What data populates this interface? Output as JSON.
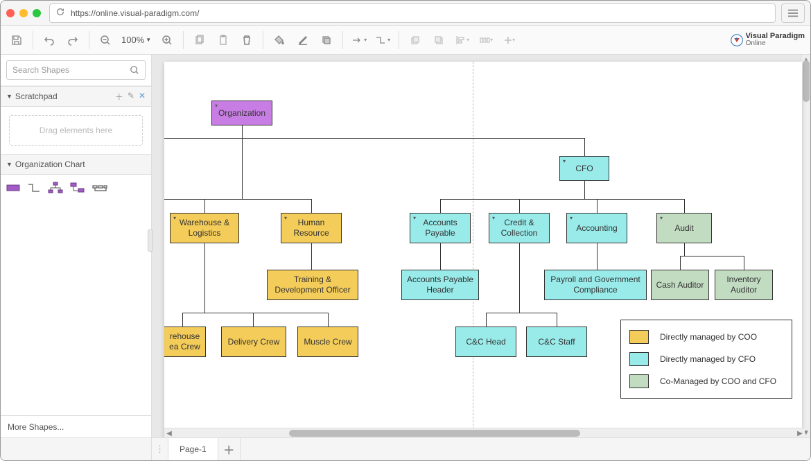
{
  "url": "https://online.visual-paradigm.com/",
  "brand": {
    "name": "Visual Paradigm",
    "sub": "Online"
  },
  "toolbar": {
    "zoom": "100%"
  },
  "sidebar": {
    "search_placeholder": "Search Shapes",
    "scratchpad_title": "Scratchpad",
    "dropzone_text": "Drag elements here",
    "orgchart_title": "Organization Chart",
    "more_shapes": "More Shapes..."
  },
  "tabs": {
    "page1": "Page-1"
  },
  "nodes": {
    "organization": "Organization",
    "cfo": "CFO",
    "warehouse": "Warehouse & Logistics",
    "hr": "Human Resource",
    "accounts_payable": "Accounts Payable",
    "credit": "Credit & Collection",
    "accounting": "Accounting",
    "audit": "Audit",
    "training": "Training & Development Officer",
    "ap_header": "Accounts Payable Header",
    "payroll": "Payroll and Government Compliance",
    "cash_auditor": "Cash Auditor",
    "inventory_auditor": "Inventory Auditor",
    "warehouse_crew": "rehouse ea Crew",
    "delivery_crew": "Delivery Crew",
    "muscle_crew": "Muscle Crew",
    "cc_head": "C&C Head",
    "cc_staff": "C&C Staff"
  },
  "legend": {
    "coo": "Directly managed by COO",
    "cfo": "Directly managed by CFO",
    "both": "Co-Managed by COO and CFO"
  },
  "chart_data": {
    "type": "org-chart",
    "root": "Organization",
    "colors": {
      "coo_managed": "#f4cc5a",
      "cfo_managed": "#99ebea",
      "co_managed": "#c2dcc2",
      "root": "#c77de3"
    },
    "nodes": [
      {
        "id": "organization",
        "label": "Organization",
        "group": "root",
        "parent": null
      },
      {
        "id": "cfo",
        "label": "CFO",
        "group": "cfo_managed",
        "parent": "organization"
      },
      {
        "id": "warehouse",
        "label": "Warehouse & Logistics",
        "group": "coo_managed",
        "parent": "organization"
      },
      {
        "id": "hr",
        "label": "Human Resource",
        "group": "coo_managed",
        "parent": "organization"
      },
      {
        "id": "accounts_payable",
        "label": "Accounts Payable",
        "group": "cfo_managed",
        "parent": "cfo"
      },
      {
        "id": "credit",
        "label": "Credit & Collection",
        "group": "cfo_managed",
        "parent": "cfo"
      },
      {
        "id": "accounting",
        "label": "Accounting",
        "group": "cfo_managed",
        "parent": "cfo"
      },
      {
        "id": "audit",
        "label": "Audit",
        "group": "co_managed",
        "parent": "cfo"
      },
      {
        "id": "training",
        "label": "Training & Development Officer",
        "group": "coo_managed",
        "parent": "hr"
      },
      {
        "id": "ap_header",
        "label": "Accounts Payable Header",
        "group": "cfo_managed",
        "parent": "accounts_payable"
      },
      {
        "id": "payroll",
        "label": "Payroll and Government Compliance",
        "group": "cfo_managed",
        "parent": "accounting"
      },
      {
        "id": "cash_auditor",
        "label": "Cash Auditor",
        "group": "co_managed",
        "parent": "audit"
      },
      {
        "id": "inventory_auditor",
        "label": "Inventory Auditor",
        "group": "co_managed",
        "parent": "audit"
      },
      {
        "id": "warehouse_crew",
        "label": "Warehouse Area Crew",
        "group": "coo_managed",
        "parent": "warehouse"
      },
      {
        "id": "delivery_crew",
        "label": "Delivery Crew",
        "group": "coo_managed",
        "parent": "warehouse"
      },
      {
        "id": "muscle_crew",
        "label": "Muscle Crew",
        "group": "coo_managed",
        "parent": "warehouse"
      },
      {
        "id": "cc_head",
        "label": "C&C Head",
        "group": "cfo_managed",
        "parent": "credit"
      },
      {
        "id": "cc_staff",
        "label": "C&C Staff",
        "group": "cfo_managed",
        "parent": "credit"
      }
    ],
    "legend": [
      {
        "label": "Directly managed by COO",
        "color": "#f4cc5a"
      },
      {
        "label": "Directly managed by CFO",
        "color": "#99ebea"
      },
      {
        "label": "Co-Managed by COO and CFO",
        "color": "#c2dcc2"
      }
    ]
  }
}
